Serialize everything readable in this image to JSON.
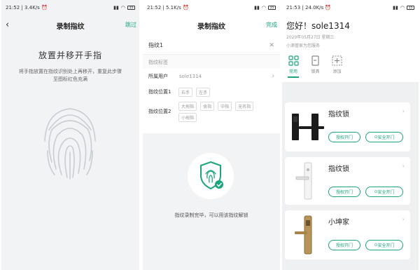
{
  "panel1": {
    "status": {
      "time": "21:52",
      "speed": "3.4K/s",
      "battery": "35"
    },
    "nav": {
      "back": "‹",
      "title": "录制指纹",
      "right": "跳过"
    },
    "heading": "放置并移开手指",
    "description": "将手指放置在指纹识别处上再移开，重复此步骤至图标红色充满"
  },
  "panel2": {
    "status": {
      "time": "21:52",
      "speed": "5.1K/s",
      "battery": "35"
    },
    "nav": {
      "title": "录制指纹",
      "right": "完成"
    },
    "input_value": "指纹1",
    "section": "指纹标签",
    "user_label": "所属用户",
    "user_value": "sole1314",
    "pos1_label": "指纹位置1",
    "pos1_options": [
      "右手",
      "左手"
    ],
    "pos2_label": "指纹位置2",
    "pos2_options": [
      "大拇指",
      "食指",
      "中指",
      "无名指",
      "小拇指"
    ],
    "done_text": "指纹录制完毕，可以用该指纹解锁"
  },
  "panel3": {
    "status": {
      "time": "21:53",
      "speed": "24.0K/s",
      "battery": "35"
    },
    "greeting": "您好！sole1314",
    "date": "2020年05月27日 星期三",
    "sub": "小滴管家为您服务",
    "tabs": [
      {
        "label": "常用",
        "icon": "grid-icon",
        "active": true
      },
      {
        "label": "锁具",
        "icon": "lock-icon",
        "active": false
      },
      {
        "label": "添加",
        "icon": "add-icon",
        "active": false
      }
    ],
    "cards": [
      {
        "name": "指纹锁",
        "btn1": "授权开门",
        "btn2": "安全开门"
      },
      {
        "name": "指纹锁",
        "btn1": "授权开门",
        "btn2": "安全开门"
      },
      {
        "name": "小坤家",
        "btn1": "授权开门",
        "btn2": "安全开门"
      }
    ]
  },
  "colors": {
    "accent": "#1aa57a",
    "bg_gray": "#f2f3f5"
  }
}
